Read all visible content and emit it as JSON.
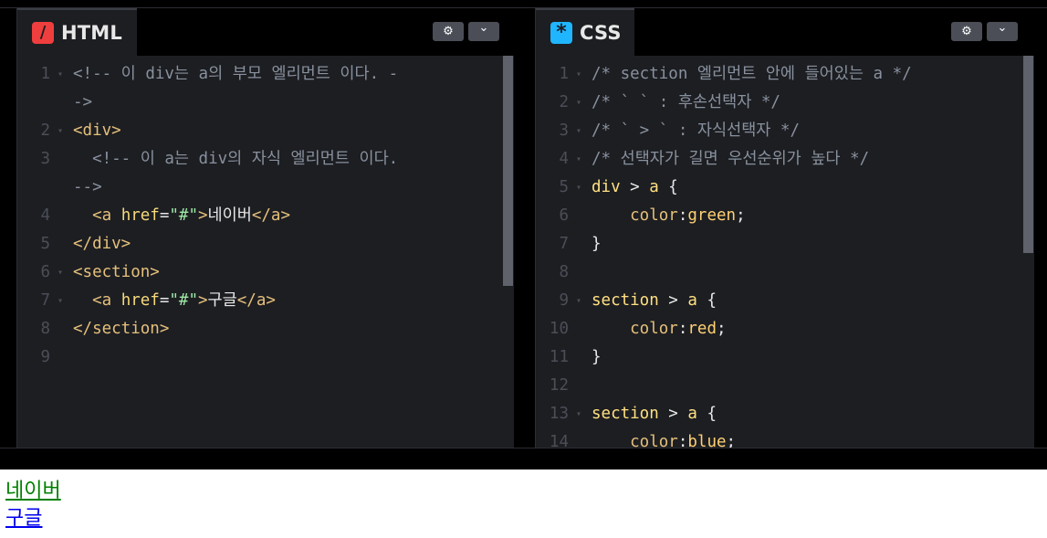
{
  "html_editor": {
    "title": "HTML",
    "icon": "/",
    "lines": [
      {
        "n": "1",
        "fold": true,
        "segs": [
          [
            "comment",
            "<!-- 이 div는 a의 부모 엘리먼트 이다. -"
          ]
        ]
      },
      {
        "n": "",
        "fold": false,
        "segs": [
          [
            "comment",
            "->"
          ]
        ]
      },
      {
        "n": "2",
        "fold": true,
        "segs": [
          [
            "tag",
            "<div>"
          ]
        ]
      },
      {
        "n": "3",
        "fold": false,
        "segs": [
          [
            "comment",
            "  <!-- 이 a는 div의 자식 엘리먼트 이다."
          ]
        ]
      },
      {
        "n": "",
        "fold": false,
        "segs": [
          [
            "comment",
            "-->"
          ]
        ]
      },
      {
        "n": "4",
        "fold": false,
        "segs": [
          [
            "tag",
            "  <a "
          ],
          [
            "attr",
            "href"
          ],
          [
            "plain",
            "="
          ],
          [
            "str",
            "\"#\""
          ],
          [
            "tag",
            ">"
          ],
          [
            "plain",
            "네이버"
          ],
          [
            "tag",
            "</a>"
          ]
        ]
      },
      {
        "n": "5",
        "fold": false,
        "segs": [
          [
            "tag",
            "</div>"
          ]
        ]
      },
      {
        "n": "6",
        "fold": true,
        "segs": [
          [
            "tag",
            "<section>"
          ]
        ]
      },
      {
        "n": "7",
        "fold": true,
        "segs": [
          [
            "tag",
            "  <a "
          ],
          [
            "attr",
            "href"
          ],
          [
            "plain",
            "="
          ],
          [
            "str",
            "\"#\""
          ],
          [
            "tag",
            ">"
          ],
          [
            "plain",
            "구글"
          ],
          [
            "tag",
            "</a>"
          ]
        ]
      },
      {
        "n": "8",
        "fold": false,
        "segs": [
          [
            "tag",
            "</section>"
          ]
        ]
      },
      {
        "n": "9",
        "fold": false,
        "segs": []
      }
    ]
  },
  "css_editor": {
    "title": "CSS",
    "icon": "*",
    "lines": [
      {
        "n": "1",
        "fold": true,
        "segs": [
          [
            "comment",
            "/* section 엘리먼트 안에 들어있는 a */"
          ]
        ]
      },
      {
        "n": "2",
        "fold": true,
        "segs": [
          [
            "comment",
            "/* ` ` : 후손선택자 */"
          ]
        ]
      },
      {
        "n": "3",
        "fold": true,
        "segs": [
          [
            "comment",
            "/* ` > ` : 자식선택자 */"
          ]
        ]
      },
      {
        "n": "4",
        "fold": true,
        "segs": [
          [
            "comment",
            "/* 선택자가 길면 우선순위가 높다 */"
          ]
        ]
      },
      {
        "n": "5",
        "fold": true,
        "segs": [
          [
            "sel",
            "div"
          ],
          [
            "plain",
            " > "
          ],
          [
            "sel",
            "a"
          ],
          [
            "plain",
            " {"
          ]
        ]
      },
      {
        "n": "6",
        "fold": false,
        "segs": [
          [
            "prop",
            "    color"
          ],
          [
            "plain",
            ":"
          ],
          [
            "val",
            "green"
          ],
          [
            "plain",
            ";"
          ]
        ]
      },
      {
        "n": "7",
        "fold": false,
        "segs": [
          [
            "plain",
            "}"
          ]
        ]
      },
      {
        "n": "8",
        "fold": false,
        "segs": []
      },
      {
        "n": "9",
        "fold": true,
        "segs": [
          [
            "sel",
            "section"
          ],
          [
            "plain",
            " > "
          ],
          [
            "sel",
            "a"
          ],
          [
            "plain",
            " {"
          ]
        ]
      },
      {
        "n": "10",
        "fold": false,
        "segs": [
          [
            "prop",
            "    color"
          ],
          [
            "plain",
            ":"
          ],
          [
            "val",
            "red"
          ],
          [
            "plain",
            ";"
          ]
        ]
      },
      {
        "n": "11",
        "fold": false,
        "segs": [
          [
            "plain",
            "}"
          ]
        ]
      },
      {
        "n": "12",
        "fold": false,
        "segs": []
      },
      {
        "n": "13",
        "fold": true,
        "segs": [
          [
            "sel",
            "section"
          ],
          [
            "plain",
            " > "
          ],
          [
            "sel",
            "a"
          ],
          [
            "plain",
            " {"
          ]
        ]
      },
      {
        "n": "14",
        "fold": false,
        "segs": [
          [
            "prop",
            "    color"
          ],
          [
            "plain",
            ":"
          ],
          [
            "val",
            "blue"
          ],
          [
            "plain",
            ";"
          ]
        ]
      }
    ]
  },
  "buttons": {
    "gear": "⚙",
    "chevron": "⌄"
  },
  "preview": {
    "link1": "네이버",
    "link2": "구글",
    "link1_color": "#008000",
    "link2_color": "#0000ee"
  }
}
